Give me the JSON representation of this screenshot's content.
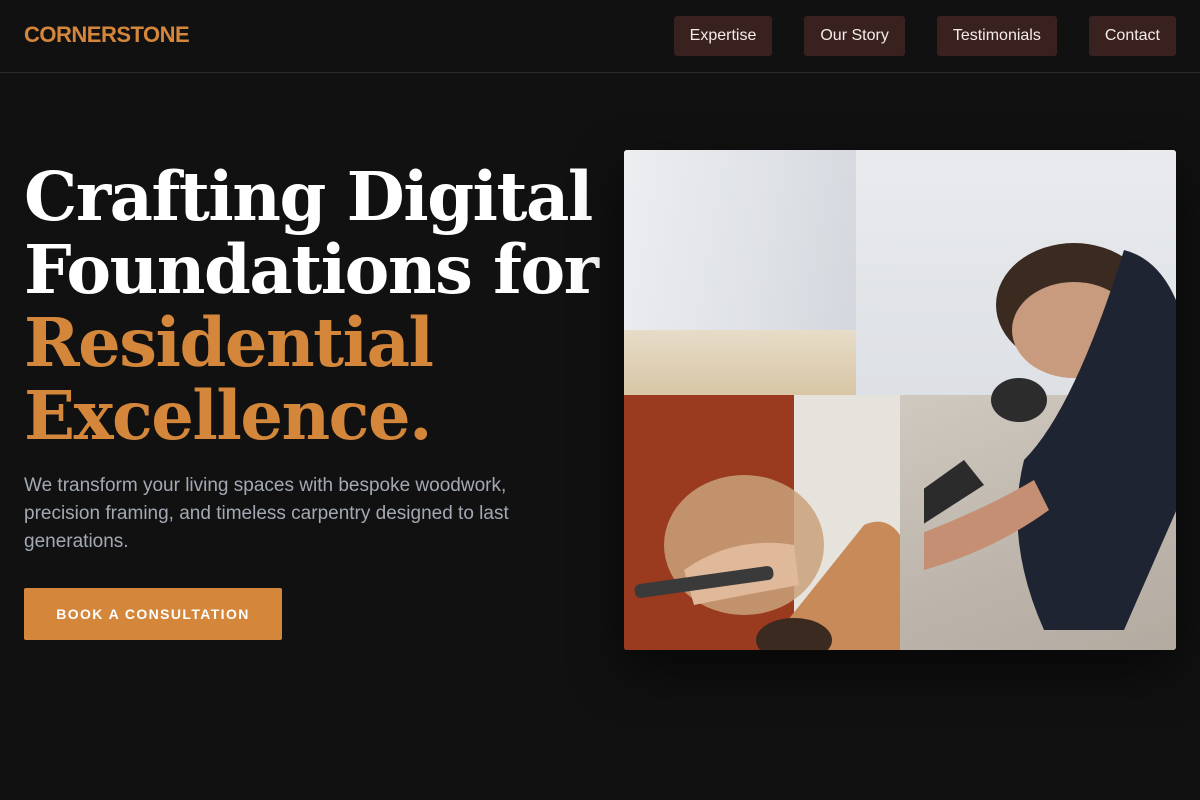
{
  "brand": {
    "name": "CORNERSTONE",
    "accent_color": "#d4863b"
  },
  "nav": {
    "items": [
      {
        "label": "Expertise"
      },
      {
        "label": "Our Story"
      },
      {
        "label": "Testimonials"
      },
      {
        "label": "Contact"
      }
    ]
  },
  "hero": {
    "headline_lines": [
      "Crafting Digital",
      "Foundations for"
    ],
    "headline_accent_lines": [
      "Residential",
      "Excellence."
    ],
    "subtext": "We transform your living spaces with bespoke woodwork, precision framing, and timeless carpentry designed to last generations.",
    "cta_label": "BOOK A CONSULTATION"
  },
  "collage": {
    "images": [
      {
        "subject": "carpenter-measuring-wall"
      },
      {
        "subject": "wood-turning-lathe"
      }
    ]
  }
}
